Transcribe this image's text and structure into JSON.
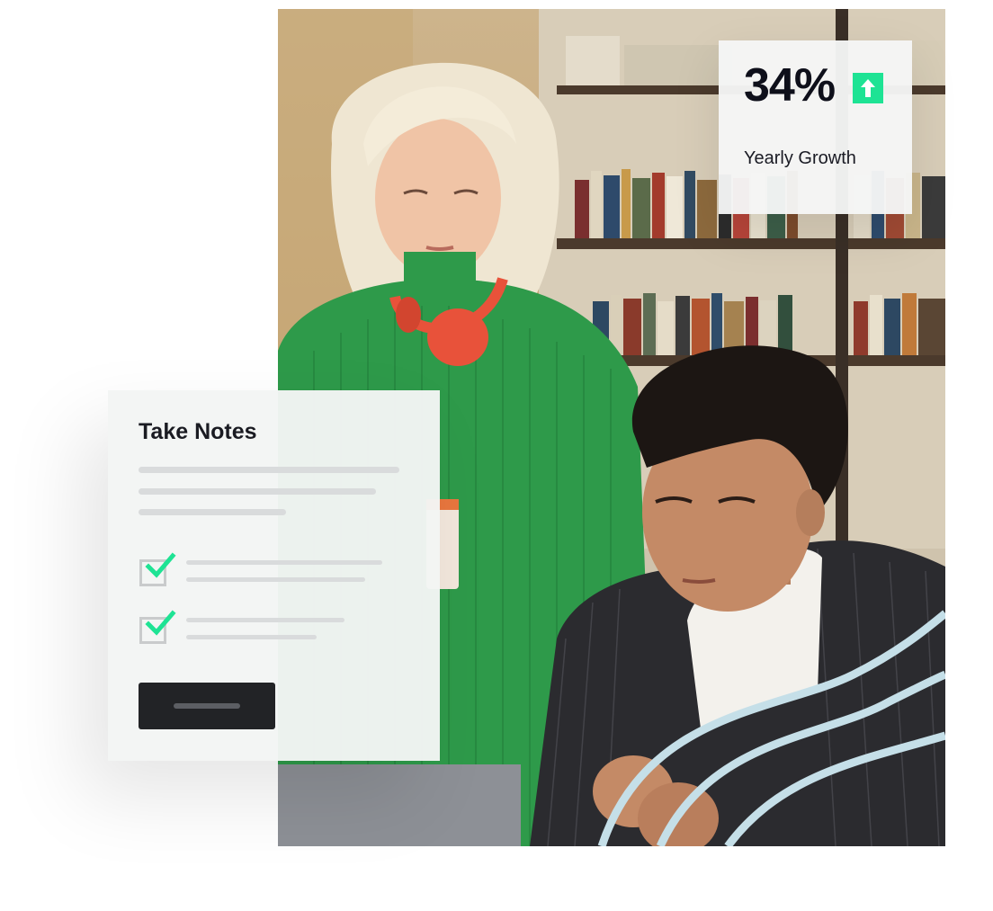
{
  "stat": {
    "value": "34%",
    "label": "Yearly Growth",
    "arrow_icon": "arrow-up-icon",
    "accent_color": "#1ee394"
  },
  "notes": {
    "title": "Take Notes",
    "check_icon": "checkmark-icon",
    "check_color": "#1ee394",
    "button_color": "#222326"
  },
  "colors": {
    "sweater": "#2e9a4a",
    "headphones": "#e8523a",
    "wave": "#c5dfe8"
  }
}
